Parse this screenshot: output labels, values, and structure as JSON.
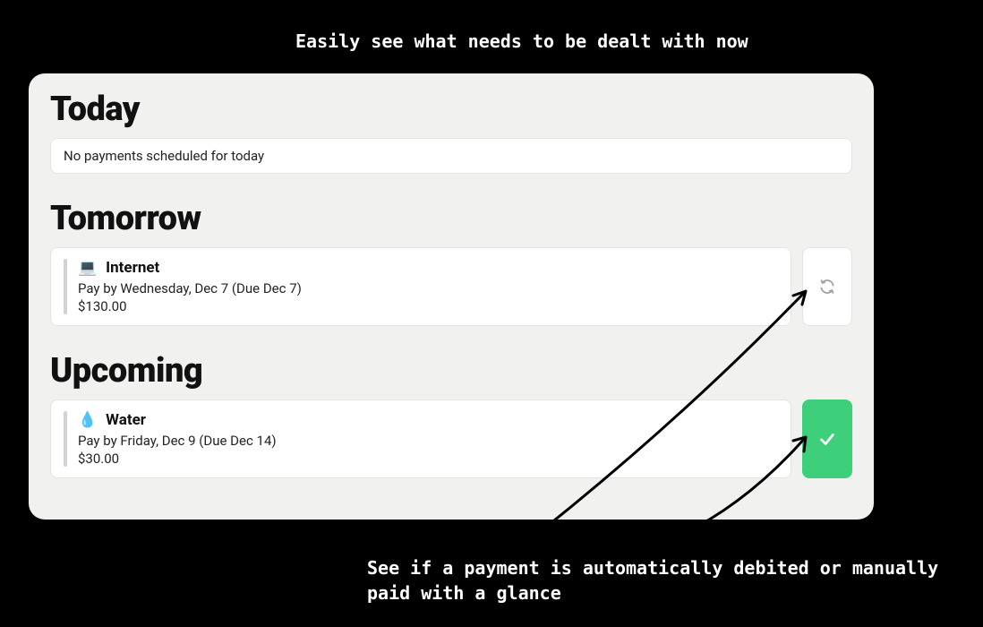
{
  "annotations": {
    "top": "Easily see what needs to be dealt with now",
    "bottom": "See if a payment is automatically debited or manually paid with a glance"
  },
  "sections": {
    "today": {
      "title": "Today",
      "empty_message": "No payments scheduled for today"
    },
    "tomorrow": {
      "title": "Tomorrow",
      "item": {
        "icon": "💻",
        "name": "Internet",
        "subtitle": "Pay by Wednesday, Dec 7 (Due Dec 7)",
        "amount": "$130.00"
      }
    },
    "upcoming": {
      "title": "Upcoming",
      "item": {
        "icon": "💧",
        "name": "Water",
        "subtitle": "Pay by Friday, Dec 9 (Due Dec 14)",
        "amount": "$30.00"
      }
    }
  }
}
